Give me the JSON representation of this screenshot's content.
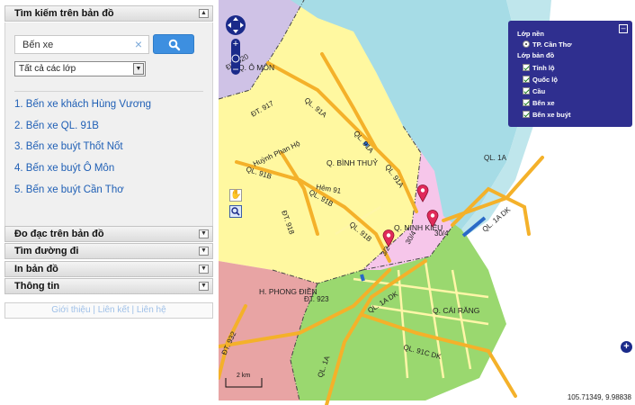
{
  "search_panel": {
    "title": "Tìm kiếm trên bản đồ",
    "toggle": "▲",
    "input_value": "Bến xe",
    "clear_glyph": "×",
    "layer_select": "Tất cả các lớp",
    "select_arrow": "▼",
    "results": [
      "1. Bến xe khách Hùng Vương",
      "2. Bến xe QL. 91B",
      "3. Bến xe buýt Thốt Nốt",
      "4. Bến xe buýt Ô Môn",
      "5. Bến xe buýt Cần Thơ"
    ]
  },
  "accordion": [
    {
      "label": "Đo đạc trên bản đồ",
      "toggle": "▼"
    },
    {
      "label": "Tìm đường đi",
      "toggle": "▼"
    },
    {
      "label": "In bản đồ",
      "toggle": "▼"
    },
    {
      "label": "Thông tin",
      "toggle": "▼"
    }
  ],
  "footer_links": "Giới thiệu | Liên kết | Liên hệ",
  "layer_panel": {
    "base_title": "Lớp nền",
    "base_option": "TP. Cần Thơ",
    "overlay_title": "Lớp bản đồ",
    "close_glyph": "–",
    "layers": [
      "Tỉnh lộ",
      "Quốc lộ",
      "Cầu",
      "Bến xe",
      "Bến xe buýt"
    ]
  },
  "map": {
    "road_labels": [
      "QL. 91A",
      "QL. 91A",
      "QL. 91A",
      "QL. 1A",
      "QL. 91B",
      "QL. 91B",
      "QL. 91B",
      "ĐT. 917",
      "ĐT. 918",
      "ĐT. 920",
      "ĐT. 923",
      "ĐT. 932",
      "QL. 1A DK",
      "QL. 1A DK",
      "QL. 91C DK",
      "QL. 1A",
      "Huỳnh Phan Hộ",
      "Hẻm 91",
      "30/4",
      "30/4",
      "3/2"
    ],
    "area_labels": [
      "Q. Ô MÔN",
      "Q. BÌNH THUỶ",
      "H. PHONG ĐIỀN",
      "Q. CÁI RĂNG",
      "Q. NINH KIỀU"
    ],
    "scale": "2 km",
    "coordinates": "105.71349, 9.98838"
  },
  "colors": {
    "river": "#a6dce6",
    "binh_thuy": "#fff8a0",
    "ninh_kieu": "#f6c6ea",
    "cai_rang": "#9ad86f",
    "phong_dien": "#e8a4a4",
    "o_mon": "#cfc2e6",
    "road": "#f4b12a",
    "panel": "#2f2f8f",
    "search_button": "#3d8fe0",
    "link": "#1f5fb5"
  }
}
